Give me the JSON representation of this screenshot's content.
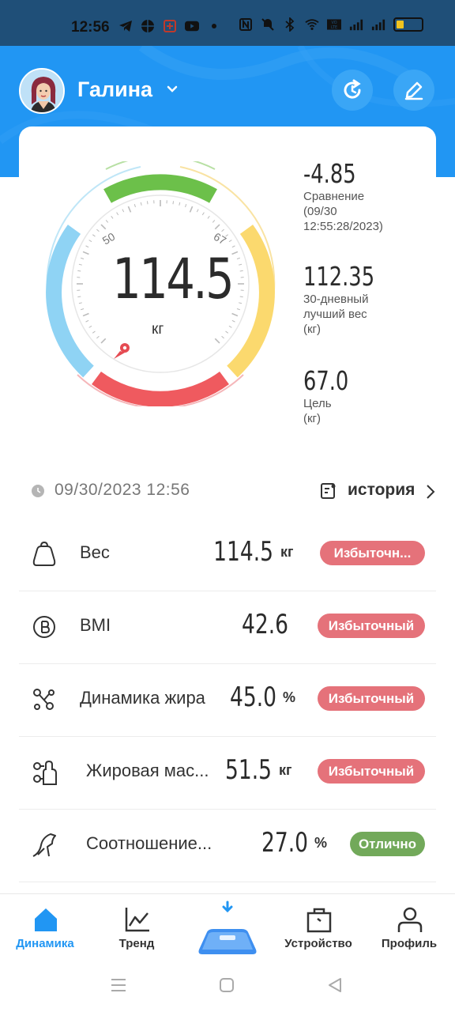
{
  "status_bar": {
    "time": "12:56",
    "battery_level": 0.3,
    "icons": [
      "telegram-icon",
      "basketball-icon",
      "app-icon",
      "youtube-icon",
      "dot-icon",
      "nfc-icon",
      "mute-icon",
      "bluetooth-icon",
      "wifi-icon",
      "volte-icon",
      "signal-icon",
      "signal-icon",
      "battery-icon"
    ]
  },
  "header": {
    "username": "Галина",
    "buttons": [
      "refresh-icon",
      "edit-icon"
    ]
  },
  "gauge": {
    "weight": "114.5",
    "unit": "кг",
    "tick_low": "50",
    "tick_high": "67",
    "colors": {
      "blue": "#8fd3f4",
      "green": "#6cc04a",
      "yellow": "#fbd96e",
      "red": "#ef5a5f"
    }
  },
  "stats": [
    {
      "value": "-4.85",
      "label": "Сравнение\n(09/30\n12:55:28/2023)"
    },
    {
      "value": "112.35",
      "label": "30-дневный\nлучший вес\n(кг)"
    },
    {
      "value": "67.0",
      "label": "Цель\n(кг)"
    }
  ],
  "date_row": {
    "datetime": "09/30/2023 12:56",
    "history_label": "история"
  },
  "metrics": [
    {
      "icon": "weight-icon",
      "name": "Вес",
      "value": "114.5",
      "unit": "кг",
      "status": "Избыточн...",
      "status_color": "#e5727a"
    },
    {
      "icon": "bmi-icon",
      "name": "BMI",
      "value": "42.6",
      "unit": "",
      "status": "Избыточный",
      "status_color": "#e5727a"
    },
    {
      "icon": "fat-dynamics-icon",
      "name": "Динамика жира",
      "value": "45.0",
      "unit": "%",
      "status": "Избыточный",
      "status_color": "#e5727a"
    },
    {
      "icon": "fat-mass-icon",
      "name": "Жировая мас...",
      "value": "51.5",
      "unit": "кг",
      "status": "Избыточный",
      "status_color": "#e5727a"
    },
    {
      "icon": "ratio-icon",
      "name": "Соотношение...",
      "value": "27.0",
      "unit": "%",
      "status": "Отлично",
      "status_color": "#72a95a"
    }
  ],
  "bottom_nav": [
    {
      "label": "Динамика",
      "icon": "home-icon",
      "active": true
    },
    {
      "label": "Тренд",
      "icon": "trend-icon",
      "active": false
    },
    {
      "label": "Устройство",
      "icon": "device-icon",
      "active": false
    },
    {
      "label": "Профиль",
      "icon": "profile-icon",
      "active": false
    }
  ],
  "accent_color": "#2196f3"
}
